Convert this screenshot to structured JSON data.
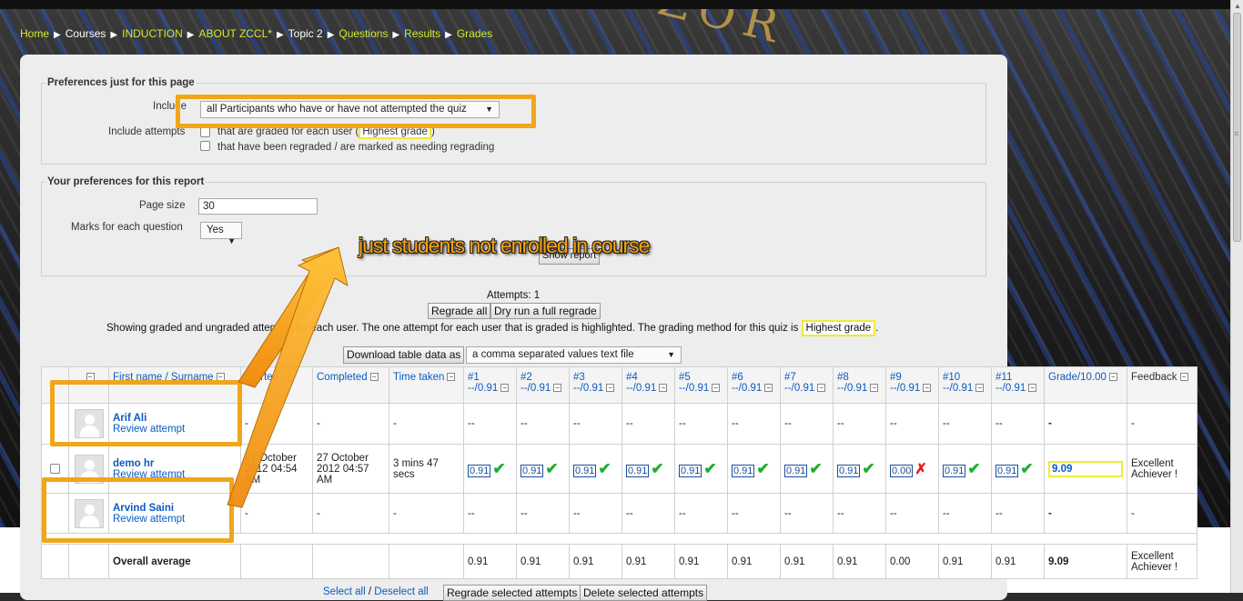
{
  "breadcrumb": [
    {
      "label": "Home",
      "style": "crumb"
    },
    {
      "label": "Courses",
      "style": "plain"
    },
    {
      "label": "INDUCTION",
      "style": "crumb"
    },
    {
      "label": "ABOUT ZCCL*",
      "style": "crumb"
    },
    {
      "label": "Topic 2",
      "style": "plain"
    },
    {
      "label": "Questions",
      "style": "crumb"
    },
    {
      "label": "Results",
      "style": "crumb"
    },
    {
      "label": "Grades",
      "style": "crumb"
    }
  ],
  "prefs_page": {
    "legend": "Preferences just for this page",
    "include_label": "Include",
    "include_value": "all Participants who have or have not attempted the quiz",
    "attempts_label": "Include attempts",
    "option1": "that are graded for each user (",
    "option1_badge": "Highest grade",
    "option1_end": ")",
    "option2": "that have been regraded / are marked as needing regrading"
  },
  "prefs_report": {
    "legend": "Your preferences for this report",
    "pagesize_label": "Page size",
    "pagesize_value": "30",
    "marks_label": "Marks for each question",
    "marks_value": "Yes",
    "show_report": "Show report"
  },
  "annotation": "just students not enrolled in course",
  "summary": {
    "attempts": "Attempts: 1",
    "regrade_all": "Regrade all",
    "dry_run": "Dry run a full regrade",
    "showing_pre": "Showing graded and ungraded attempts for each user. The one attempt for each user that is graded is highlighted. The grading method for this quiz is",
    "method": "Highest grade",
    "showing_post": ".",
    "download_btn": "Download table data as",
    "download_format": "a comma separated values text file"
  },
  "table": {
    "headers": {
      "name": "First name / Surname",
      "started": "Started",
      "completed": "Completed",
      "time": "Time taken",
      "grade": "Grade/10.00",
      "feedback": "Feedback"
    },
    "questions": [
      "#1",
      "#2",
      "#3",
      "#4",
      "#5",
      "#6",
      "#7",
      "#8",
      "#9",
      "#10",
      "#11"
    ],
    "question_max": "--/0.91",
    "rows": [
      {
        "name": "Arif Ali",
        "review": "Review attempt",
        "started": "-",
        "completed": "-",
        "time": "-",
        "marks": [
          "--",
          "--",
          "--",
          "--",
          "--",
          "--",
          "--",
          "--",
          "--",
          "--",
          "--"
        ],
        "grade": "-",
        "feedback": "-"
      },
      {
        "name": "demo hr",
        "review": "Review attempt",
        "started": "27 October 2012 04:54 AM",
        "completed": "27 October 2012 04:57 AM",
        "time": "3 mins 47 secs",
        "marks": [
          "0.91",
          "0.91",
          "0.91",
          "0.91",
          "0.91",
          "0.91",
          "0.91",
          "0.91",
          "0.00",
          "0.91",
          "0.91"
        ],
        "grade": "9.09",
        "feedback": "Excellent Achiever !"
      },
      {
        "name": "Arvind Saini",
        "review": "Review attempt",
        "started": "-",
        "completed": "-",
        "time": "-",
        "marks": [
          "--",
          "--",
          "--",
          "--",
          "--",
          "--",
          "--",
          "--",
          "--",
          "--",
          "--"
        ],
        "grade": "-",
        "feedback": "-"
      }
    ],
    "average": {
      "label": "Overall average",
      "marks": [
        "0.91",
        "0.91",
        "0.91",
        "0.91",
        "0.91",
        "0.91",
        "0.91",
        "0.91",
        "0.00",
        "0.91",
        "0.91"
      ],
      "grade": "9.09",
      "feedback": "Excellent Achiever !"
    }
  },
  "footer": {
    "select_all": "Select all",
    "slash": " / ",
    "deselect_all": "Deselect all",
    "regrade_selected": "Regrade selected attempts",
    "delete_selected": "Delete selected attempts"
  },
  "bg_text": "ZOR"
}
